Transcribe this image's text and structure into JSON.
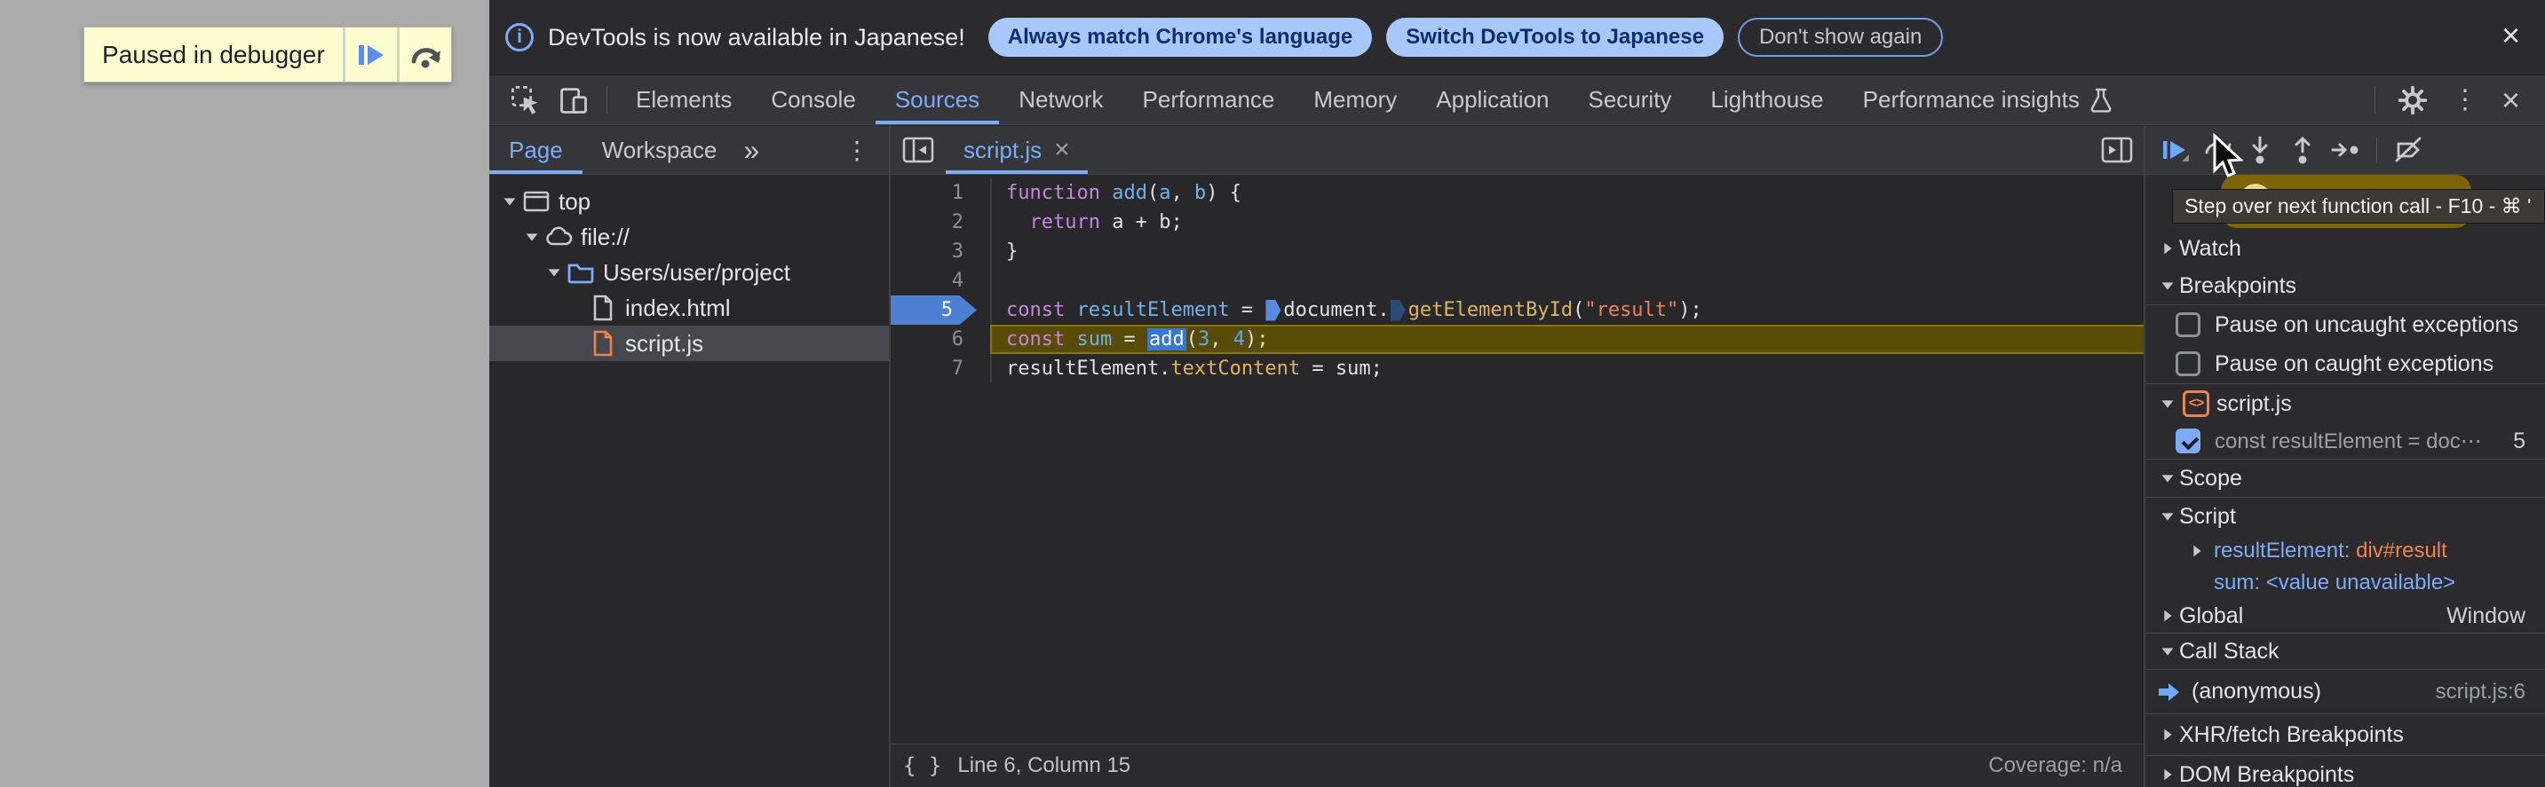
{
  "page": {
    "paused_banner": {
      "text": "Paused in debugger"
    }
  },
  "infobar": {
    "message": "DevTools is now available in Japanese!",
    "actions": [
      {
        "label": "Always match Chrome's language",
        "style": "filled"
      },
      {
        "label": "Switch DevTools to Japanese",
        "style": "filled"
      },
      {
        "label": "Don't show again",
        "style": "outlined"
      }
    ],
    "close_glyph": "×"
  },
  "tabbar": {
    "tabs": [
      {
        "label": "Elements"
      },
      {
        "label": "Console"
      },
      {
        "label": "Sources",
        "active": true
      },
      {
        "label": "Network"
      },
      {
        "label": "Performance"
      },
      {
        "label": "Memory"
      },
      {
        "label": "Application"
      },
      {
        "label": "Security"
      },
      {
        "label": "Lighthouse"
      },
      {
        "label": "Performance insights",
        "icon": "flask"
      }
    ],
    "more_glyph": "⋮",
    "close_glyph": "×"
  },
  "navigator": {
    "tabs": [
      {
        "label": "Page",
        "active": true
      },
      {
        "label": "Workspace",
        "active": false
      }
    ],
    "more_tabs_glyph": "»",
    "menu_glyph": "⋮",
    "tree": [
      {
        "name": "tree-row-top",
        "label": "top",
        "icon": "frame",
        "caret": "down",
        "indent": 0
      },
      {
        "name": "tree-row-file-protocol",
        "label": "file://",
        "icon": "cloud",
        "caret": "down",
        "indent": 1
      },
      {
        "name": "tree-row-project-folder",
        "label": "Users/user/project",
        "icon": "folder",
        "caret": "down",
        "indent": 2
      },
      {
        "name": "tree-row-index-html",
        "label": "index.html",
        "icon": "file",
        "caret": null,
        "indent": 3
      },
      {
        "name": "tree-row-script-js",
        "label": "script.js",
        "icon": "file-js",
        "caret": null,
        "indent": 3,
        "selected": true
      }
    ]
  },
  "editor": {
    "tab": {
      "label": "script.js",
      "close_glyph": "×"
    },
    "code": {
      "lines": [
        {
          "n": 1,
          "t": [
            [
              "kw",
              "function"
            ],
            [
              "pl",
              " "
            ],
            [
              "vr",
              "add"
            ],
            [
              "pl",
              "("
            ],
            [
              "vr",
              "a"
            ],
            [
              "pl",
              ", "
            ],
            [
              "vr",
              "b"
            ],
            [
              "pl",
              ") {"
            ]
          ]
        },
        {
          "n": 2,
          "t": [
            [
              "pl",
              "  "
            ],
            [
              "kw",
              "return"
            ],
            [
              "pl",
              " a + b;"
            ]
          ]
        },
        {
          "n": 3,
          "t": [
            [
              "pl",
              "}"
            ]
          ]
        },
        {
          "n": 4,
          "t": []
        },
        {
          "n": 5,
          "breakpoint": true,
          "t": [
            [
              "kw",
              "const"
            ],
            [
              "pl",
              " "
            ],
            [
              "vr",
              "resultElement"
            ],
            [
              "pl",
              " = "
            ],
            [
              "mk1",
              ""
            ],
            [
              "pl",
              "document."
            ],
            [
              "mk2",
              ""
            ],
            [
              "pr",
              "getElementById"
            ],
            [
              "pl",
              "("
            ],
            [
              "st",
              "\"result\""
            ],
            [
              "pl",
              ");"
            ]
          ]
        },
        {
          "n": 6,
          "current": true,
          "t": [
            [
              "kw",
              "const"
            ],
            [
              "pl",
              " "
            ],
            [
              "vr",
              "sum"
            ],
            [
              "pl",
              " = "
            ],
            [
              "sel",
              "add"
            ],
            [
              "pl",
              "("
            ],
            [
              "nm",
              "3"
            ],
            [
              "pl",
              ", "
            ],
            [
              "nm",
              "4"
            ],
            [
              "pl",
              ");"
            ]
          ]
        },
        {
          "n": 7,
          "t": [
            [
              "pl",
              "resultElement."
            ],
            [
              "pr",
              "textContent"
            ],
            [
              "pl",
              " = sum;"
            ]
          ]
        }
      ]
    },
    "status": {
      "format_glyph": "{ }",
      "line_col": "Line 6, Column 15",
      "coverage": "Coverage: n/a"
    }
  },
  "sidebar": {
    "toolbar": [
      {
        "name": "resume-button",
        "icon": "resume"
      },
      {
        "name": "step-over-button",
        "icon": "step-over"
      },
      {
        "name": "step-into-button",
        "icon": "step-into"
      },
      {
        "name": "step-out-button",
        "icon": "step-out"
      },
      {
        "name": "step-button",
        "icon": "step"
      },
      {
        "name": "separator",
        "icon": "sep"
      },
      {
        "name": "deactivate-breakpoints-button",
        "icon": "deactivate"
      }
    ],
    "tooltip": "Step over next function call - F10 - ⌘ '",
    "rows": [
      {
        "type": "header",
        "caret": "right",
        "label": "Watch",
        "name": "section-watch",
        "h": 42
      },
      {
        "type": "header",
        "caret": "down",
        "label": "Breakpoints",
        "name": "section-breakpoints",
        "h": 42
      },
      {
        "type": "divider"
      },
      {
        "type": "checkbox",
        "checked": false,
        "label": "Pause on uncaught exceptions",
        "name": "pause-uncaught-checkbox",
        "h": 44
      },
      {
        "type": "checkbox",
        "checked": false,
        "label": "Pause on caught exceptions",
        "name": "pause-caught-checkbox",
        "h": 44
      },
      {
        "type": "divider"
      },
      {
        "type": "group",
        "caret": "down",
        "label": "script.js",
        "name": "breakpoint-group-scriptjs",
        "h": 44
      },
      {
        "type": "bp",
        "checked": true,
        "label": "const resultElement = doc⋯",
        "right": "5",
        "name": "breakpoint-entry-line5",
        "h": 40
      },
      {
        "type": "divider"
      },
      {
        "type": "header",
        "caret": "down",
        "label": "Scope",
        "name": "section-scope",
        "h": 42
      },
      {
        "type": "divider"
      },
      {
        "type": "scopehead",
        "caret": "down",
        "label": "Script",
        "name": "scope-script",
        "h": 42
      },
      {
        "type": "prop",
        "caret": "right",
        "parts": [
          [
            "c-blue",
            "resultElement"
          ],
          [
            "c-dim",
            ": "
          ],
          [
            "c-orange",
            "div#result"
          ]
        ],
        "name": "scope-var-resultelement",
        "h": 36
      },
      {
        "type": "prop",
        "caret": null,
        "parts": [
          [
            "c-blue",
            "sum"
          ],
          [
            "c-dim",
            ": "
          ],
          [
            "c-val",
            "<value unavailable>"
          ]
        ],
        "name": "scope-var-sum",
        "h": 36
      },
      {
        "type": "scopehead",
        "caret": "right",
        "label": "Global",
        "right": "Window",
        "name": "scope-global",
        "h": 38
      },
      {
        "type": "divider"
      },
      {
        "type": "header",
        "caret": "down",
        "label": "Call Stack",
        "name": "section-call-stack",
        "h": 40
      },
      {
        "type": "divider"
      },
      {
        "type": "frame",
        "label": "(anonymous)",
        "right": "script.js:6",
        "name": "call-stack-frame-anonymous",
        "h": 49
      },
      {
        "type": "divider"
      },
      {
        "type": "header",
        "caret": "right",
        "label": "XHR/fetch Breakpoints",
        "name": "section-xhr-breakpoints",
        "h": 46
      },
      {
        "type": "divider"
      },
      {
        "type": "header",
        "caret": "right",
        "label": "DOM Breakpoints",
        "name": "section-dom-breakpoints",
        "h": 42
      }
    ]
  }
}
